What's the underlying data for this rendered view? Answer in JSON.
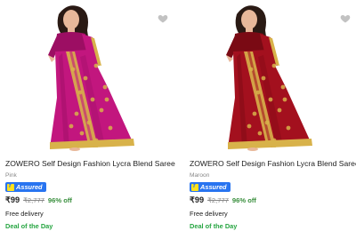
{
  "products": [
    {
      "title": "ZOWERO Self Design Fashion Lycra Blend Saree",
      "color": "Pink",
      "assured_label": "Assured",
      "price": "₹99",
      "mrp": "₹2,777",
      "discount": "96% off",
      "delivery": "Free delivery",
      "deal": "Deal of the Day",
      "image_icon": "saree-model-image",
      "saree_color": "#c2167e",
      "saree_shade": "#9c0e63",
      "border_color": "#d8b24a"
    },
    {
      "title": "ZOWERO Self Design Fashion Lycra Blend Saree",
      "color": "Maroon",
      "assured_label": "Assured",
      "price": "₹99",
      "mrp": "₹2,777",
      "discount": "96% off",
      "delivery": "Free delivery",
      "deal": "Deal of the Day",
      "image_icon": "saree-model-image",
      "saree_color": "#a3101e",
      "saree_shade": "#7a0a14",
      "border_color": "#d8b24a"
    }
  ],
  "colors": {
    "assured_blue": "#2874f0",
    "discount_green": "#388e3c",
    "deal_green": "#26a541",
    "muted_text": "#878787"
  }
}
